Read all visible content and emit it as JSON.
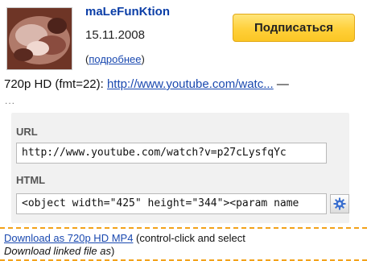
{
  "channel": {
    "name": "maLeFunKtion",
    "date": "15.11.2008",
    "more_prefix": "(",
    "more_link": "подробнее",
    "more_suffix": ")"
  },
  "subscribe": {
    "label": "Подписаться"
  },
  "hd": {
    "prefix": "720p HD (fmt=22): ",
    "link": "http://www.youtube.com/watc...",
    "suffix": " —",
    "ellipsis": "..."
  },
  "share": {
    "url_label": "URL",
    "url_value": "http://www.youtube.com/watch?v=p27cLysfqYc",
    "html_label": "HTML",
    "html_value": "<object width=\"425\" height=\"344\"><param name"
  },
  "download": {
    "link": "Download as 720p HD MP4",
    "text_after": " (control-click and select ",
    "italic": "Download linked file as",
    "close": ")"
  },
  "colors": {
    "link": "#1a49b0",
    "channel": "#0b3ea7",
    "subscribe_bg": "#ffd03a",
    "dash": "#f3a21a"
  },
  "icons": {
    "gear": "gear-icon",
    "avatar": "avatar-image"
  }
}
